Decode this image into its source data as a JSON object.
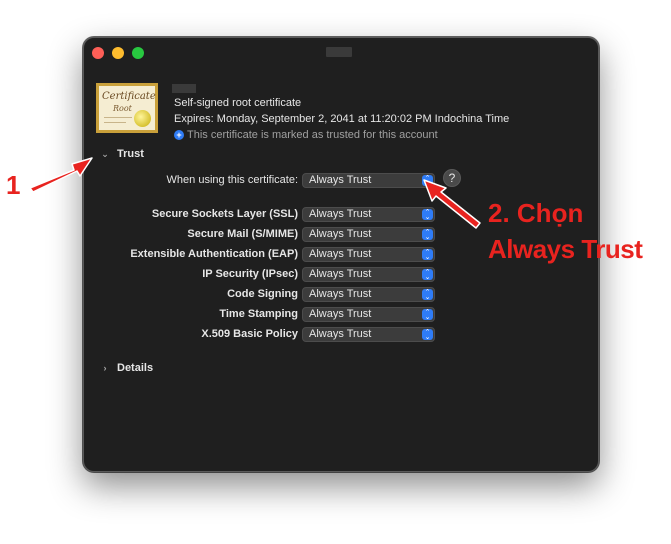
{
  "certificate": {
    "icon_title": "Certificate",
    "icon_subtitle": "Root",
    "type": "Self-signed root certificate",
    "expires": "Expires: Monday, September 2, 2041 at 11:20:02 PM Indochina Time",
    "trusted_note": "This certificate is marked as trusted for this account"
  },
  "trust": {
    "header": "Trust",
    "when_using_label": "When using this certificate:",
    "when_using_value": "Always Trust",
    "help_label": "?",
    "policies": [
      {
        "label": "Secure Sockets Layer (SSL)",
        "value": "Always Trust"
      },
      {
        "label": "Secure Mail (S/MIME)",
        "value": "Always Trust"
      },
      {
        "label": "Extensible Authentication (EAP)",
        "value": "Always Trust"
      },
      {
        "label": "IP Security (IPsec)",
        "value": "Always Trust"
      },
      {
        "label": "Code Signing",
        "value": "Always Trust"
      },
      {
        "label": "Time Stamping",
        "value": "Always Trust"
      },
      {
        "label": "X.509 Basic Policy",
        "value": "Always Trust"
      }
    ]
  },
  "details": {
    "header": "Details"
  },
  "annotations": {
    "step1": "1",
    "step2_line1": "2. Chọn",
    "step2_line2": "Always Trust",
    "color": "#e8231f"
  }
}
